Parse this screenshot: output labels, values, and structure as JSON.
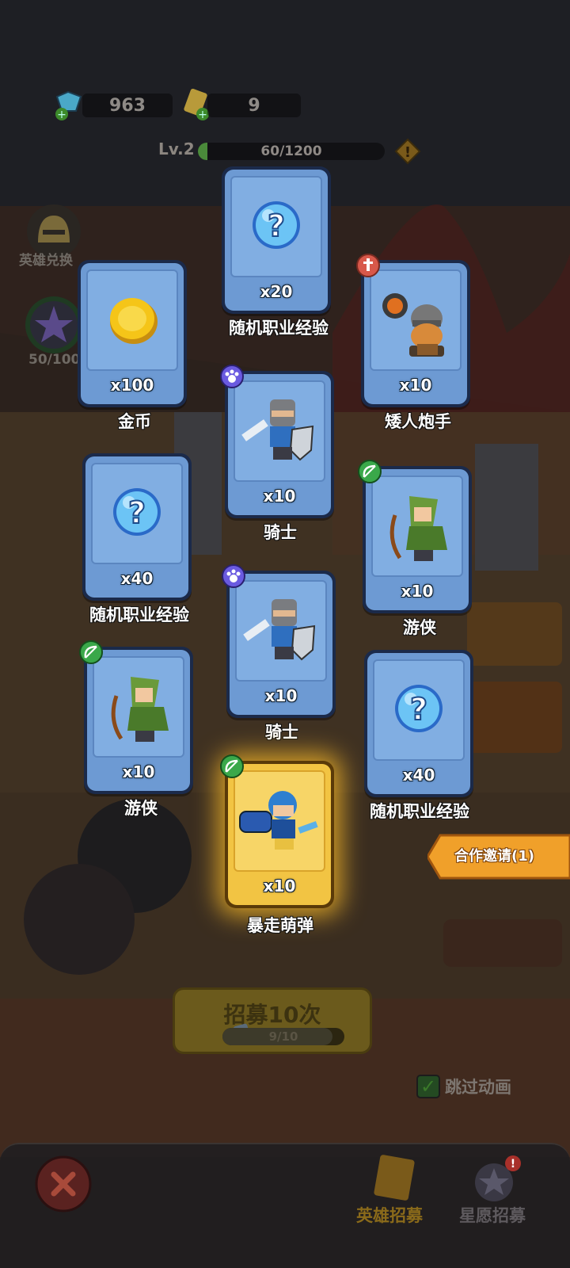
{
  "currency": {
    "gems": "963",
    "tickets": "9"
  },
  "level": {
    "label": "Lv.2",
    "xp_text": "60/1200",
    "xp_fraction": 0.05
  },
  "side": {
    "hero_exchange_label": "英雄兑换",
    "star_progress_text": "50/100"
  },
  "cards": [
    {
      "qty": "x100",
      "label": "金币",
      "art": "gold-coin",
      "rarity": "blue",
      "badge": "none"
    },
    {
      "qty": "x20",
      "label": "随机职业经验",
      "art": "question-orb",
      "rarity": "blue",
      "badge": "none"
    },
    {
      "qty": "x10",
      "label": "矮人炮手",
      "art": "dwarf-gunner",
      "rarity": "blue",
      "badge": "sword-class"
    },
    {
      "qty": "x10",
      "label": "骑士",
      "art": "knight",
      "rarity": "blue",
      "badge": "paw-class"
    },
    {
      "qty": "x40",
      "label": "随机职业经验",
      "art": "question-orb",
      "rarity": "blue",
      "badge": "none"
    },
    {
      "qty": "x10",
      "label": "游侠",
      "art": "ranger",
      "rarity": "blue",
      "badge": "bow-class"
    },
    {
      "qty": "x10",
      "label": "骑士",
      "art": "knight",
      "rarity": "blue",
      "badge": "paw-class"
    },
    {
      "qty": "x10",
      "label": "游侠",
      "art": "ranger",
      "rarity": "blue",
      "badge": "bow-class"
    },
    {
      "qty": "x40",
      "label": "随机职业经验",
      "art": "question-orb",
      "rarity": "blue",
      "badge": "none"
    },
    {
      "qty": "x10",
      "label": "暴走萌弹",
      "art": "bomber",
      "rarity": "gold",
      "badge": "bow-class"
    }
  ],
  "coop_invite": {
    "label": "合作邀请(1)"
  },
  "recruit": {
    "label": "招募10次",
    "progress_text": "9/10",
    "progress_fraction": 0.9
  },
  "skip_animation": {
    "label": "跳过动画",
    "checked": true
  },
  "bottom_nav": {
    "hero_recruit": "英雄招募",
    "wish_recruit": "星愿招募"
  },
  "colors": {
    "card_blue": "#6d9ad3",
    "card_gold": "#f2c443",
    "coop_orange": "#f0a02a"
  }
}
